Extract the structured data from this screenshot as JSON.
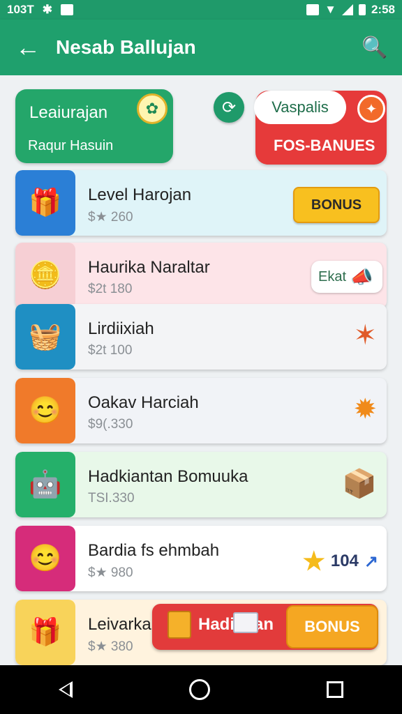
{
  "status_bar": {
    "time_left": "103T",
    "time_right": "2:58"
  },
  "app_bar": {
    "title": "Nesab Ballujan",
    "back_icon": "arrow-left-icon",
    "search_icon": "search-icon"
  },
  "top_cards": {
    "left": {
      "title": "Leaiurajan",
      "subtitle": "Raqur Hasuin"
    },
    "right": {
      "pill": "Vaspalis",
      "subtitle": "FOS-BANUES"
    }
  },
  "rows": [
    {
      "name": "Level Harojan",
      "value": "$★ 260",
      "action": "BONUS",
      "color": "#dff4f8"
    },
    {
      "name": "Haurika Naraltar",
      "value": "$2t 180",
      "action": "Ekat",
      "color": "#fde4e8"
    },
    {
      "name": "Lirdiixiah",
      "value": "$2t 100",
      "color": "#f3f4f6"
    },
    {
      "name": "Oakav Harciah",
      "value": "$9(.330",
      "color": "#f1f3f7"
    },
    {
      "name": "Hadkiantan Bomuuka",
      "value": "TSI.330",
      "color": "#e8f8e9"
    },
    {
      "name": "Bardia fs ehmbah",
      "value": "$★ 980",
      "count": "104",
      "color": "#ffffff"
    },
    {
      "name": "Leivarka",
      "value": "$★ 380",
      "color": "#fff3de"
    }
  ],
  "overlay": {
    "text": "Hadiojian",
    "button": "BONUS"
  },
  "colors": {
    "primary": "#1fa06d",
    "accent_red": "#e63a3a",
    "bonus_yellow": "#f8c01f"
  }
}
